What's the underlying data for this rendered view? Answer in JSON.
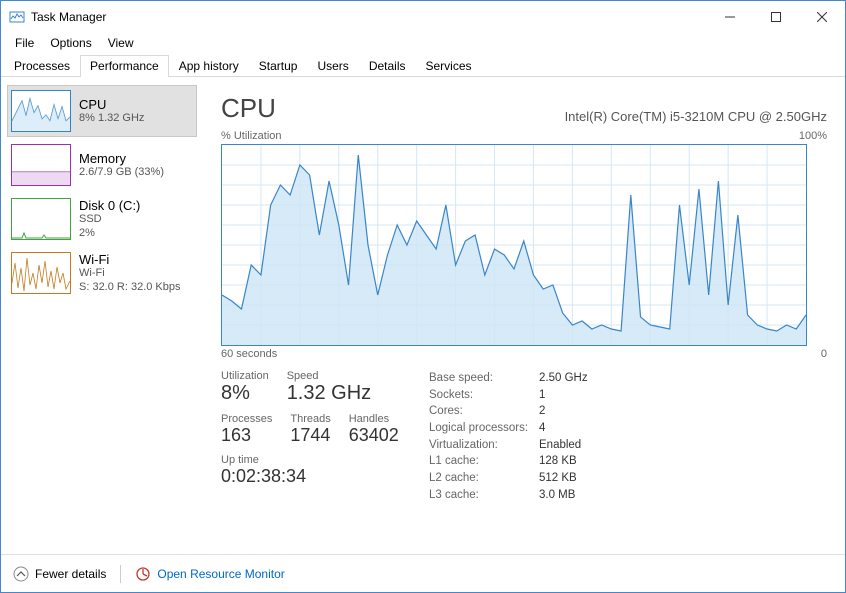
{
  "window": {
    "title": "Task Manager"
  },
  "menu": {
    "file": "File",
    "options": "Options",
    "view": "View"
  },
  "tabs": [
    "Processes",
    "Performance",
    "App history",
    "Startup",
    "Users",
    "Details",
    "Services"
  ],
  "active_tab": 1,
  "sidebar": [
    {
      "title": "CPU",
      "subtitle": "8%  1.32 GHz",
      "color": "#2f86c6"
    },
    {
      "title": "Memory",
      "subtitle": "2.6/7.9 GB (33%)",
      "color": "#9b2fae"
    },
    {
      "title": "Disk 0 (C:)",
      "subtitle": "SSD\n2%",
      "color": "#3fa33f"
    },
    {
      "title": "Wi-Fi",
      "subtitle": "Wi-Fi\nS: 32.0  R: 32.0 Kbps",
      "color": "#c47a1d"
    }
  ],
  "main": {
    "title": "CPU",
    "subtitle": "Intel(R) Core(TM) i5-3210M CPU @ 2.50GHz",
    "chart_top_left": "% Utilization",
    "chart_top_right": "100%",
    "chart_bottom_left": "60 seconds",
    "chart_bottom_right": "0"
  },
  "stats_left": {
    "utilization_label": "Utilization",
    "utilization": "8%",
    "speed_label": "Speed",
    "speed": "1.32 GHz",
    "processes_label": "Processes",
    "processes": "163",
    "threads_label": "Threads",
    "threads": "1744",
    "handles_label": "Handles",
    "handles": "63402",
    "uptime_label": "Up time",
    "uptime": "0:02:38:34"
  },
  "specs": [
    {
      "k": "Base speed:",
      "v": "2.50 GHz"
    },
    {
      "k": "Sockets:",
      "v": "1"
    },
    {
      "k": "Cores:",
      "v": "2"
    },
    {
      "k": "Logical processors:",
      "v": "4"
    },
    {
      "k": "Virtualization:",
      "v": "Enabled"
    },
    {
      "k": "L1 cache:",
      "v": "128 KB"
    },
    {
      "k": "L2 cache:",
      "v": "512 KB"
    },
    {
      "k": "L3 cache:",
      "v": "3.0 MB"
    }
  ],
  "footer": {
    "fewer": "Fewer details",
    "orm": "Open Resource Monitor"
  },
  "chart_data": {
    "type": "line",
    "title": "% Utilization",
    "xlabel": "60 seconds → 0",
    "ylabel": "% Utilization",
    "ylim": [
      0,
      100
    ],
    "x_seconds_ago": [
      60,
      59,
      58,
      57,
      56,
      55,
      54,
      53,
      52,
      51,
      50,
      49,
      48,
      47,
      46,
      45,
      44,
      43,
      42,
      41,
      40,
      39,
      38,
      37,
      36,
      35,
      34,
      33,
      32,
      31,
      30,
      29,
      28,
      27,
      26,
      25,
      24,
      23,
      22,
      21,
      20,
      19,
      18,
      17,
      16,
      15,
      14,
      13,
      12,
      11,
      10,
      9,
      8,
      7,
      6,
      5,
      4,
      3,
      2,
      1,
      0
    ],
    "values": [
      25,
      22,
      18,
      40,
      35,
      70,
      80,
      75,
      90,
      85,
      55,
      82,
      60,
      30,
      95,
      50,
      25,
      45,
      60,
      50,
      62,
      55,
      48,
      70,
      40,
      52,
      55,
      35,
      48,
      45,
      38,
      52,
      35,
      28,
      30,
      16,
      10,
      12,
      8,
      10,
      8,
      7,
      75,
      14,
      10,
      9,
      8,
      70,
      30,
      78,
      25,
      82,
      20,
      65,
      15,
      10,
      8,
      7,
      10,
      8,
      15
    ]
  }
}
